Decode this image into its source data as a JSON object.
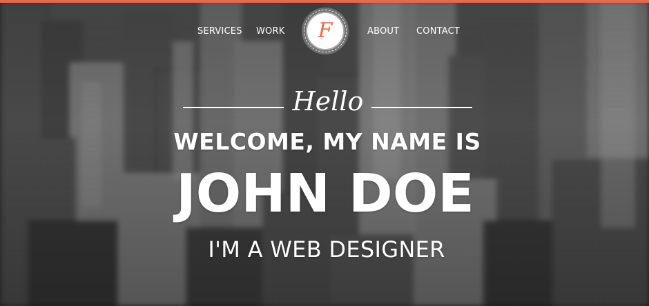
{
  "theme": {
    "accent_color": "#e9694b",
    "text_color": "#ffffff",
    "background": "blurred black-and-white city skyline photo"
  },
  "nav": {
    "items": [
      {
        "label": "SERVICES"
      },
      {
        "label": "WORK"
      },
      {
        "label": "ABOUT"
      },
      {
        "label": "CONTACT"
      }
    ],
    "logo": {
      "letter": "F",
      "icon": "script-f-logo-badge"
    }
  },
  "hero": {
    "greeting": "Hello",
    "welcome": "WELCOME, MY NAME IS",
    "name": "JOHN DOE",
    "role": "I'M A WEB DESIGNER"
  }
}
